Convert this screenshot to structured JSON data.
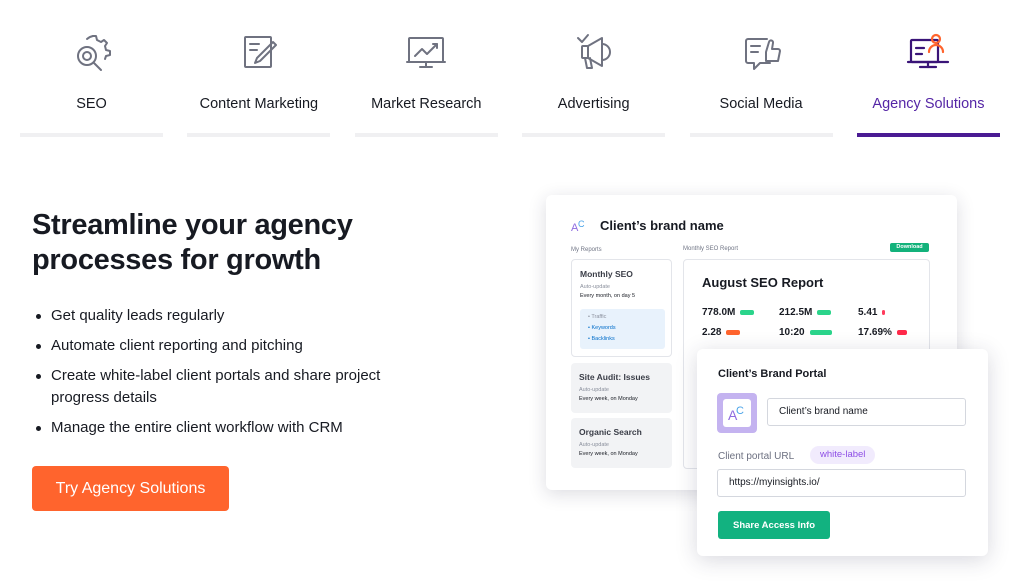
{
  "tabs": [
    {
      "label": "SEO",
      "icon": "seo-gear-search-icon",
      "active": false
    },
    {
      "label": "Content Marketing",
      "icon": "edit-document-icon",
      "active": false
    },
    {
      "label": "Market Research",
      "icon": "presentation-chart-icon",
      "active": false
    },
    {
      "label": "Advertising",
      "icon": "megaphone-icon",
      "active": false
    },
    {
      "label": "Social Media",
      "icon": "chat-thumbs-up-icon",
      "active": false
    },
    {
      "label": "Agency Solutions",
      "icon": "presenter-person-icon",
      "active": true
    }
  ],
  "hero": {
    "title": "Streamline your agency processes for growth",
    "bullets": [
      "Get quality leads regularly",
      "Automate client reporting and pitching",
      "Create white-label client portals and share project progress details",
      "Manage the entire client workflow with CRM"
    ],
    "cta_label": "Try Agency Solutions"
  },
  "report_card": {
    "brand_name": "Client’s brand name",
    "my_reports_label": "My Reports",
    "monthly_label": "Monthly SEO Report",
    "download_label": "Download",
    "reports": [
      {
        "title": "Monthly SEO",
        "sub1": "Auto-update",
        "sub2": "Every month, on day 5",
        "links": [
          "Traffic",
          "Keywords",
          "Backlinks"
        ]
      },
      {
        "title": "Site Audit: Issues",
        "sub1": "Auto-update",
        "sub2": "Every week, on Monday"
      },
      {
        "title": "Organic Search",
        "sub1": "Auto-update",
        "sub2": "Every week, on Monday"
      }
    ],
    "report_title": "August SEO Report",
    "metrics": [
      {
        "value": "778.0M",
        "color": "#2bd48b"
      },
      {
        "value": "212.5M",
        "color": "#2bd48b"
      },
      {
        "value": "5.41",
        "color": "#ff3b5c"
      },
      {
        "value": "2.28",
        "color": "#ff642d"
      },
      {
        "value": "10:20",
        "color": "#2bd48b"
      },
      {
        "value": "17.69%",
        "color": "#ff2a4a"
      }
    ]
  },
  "portal": {
    "title": "Client’s Brand Portal",
    "name_value": "Client’s brand name",
    "url_label": "Client portal URL",
    "badge": "white-label",
    "url_value": "https://myinsights.io/",
    "share_label": "Share Access Info"
  },
  "colors": {
    "accent_purple": "#4a1b93",
    "cta_orange": "#ff642d",
    "green": "#12b280"
  }
}
